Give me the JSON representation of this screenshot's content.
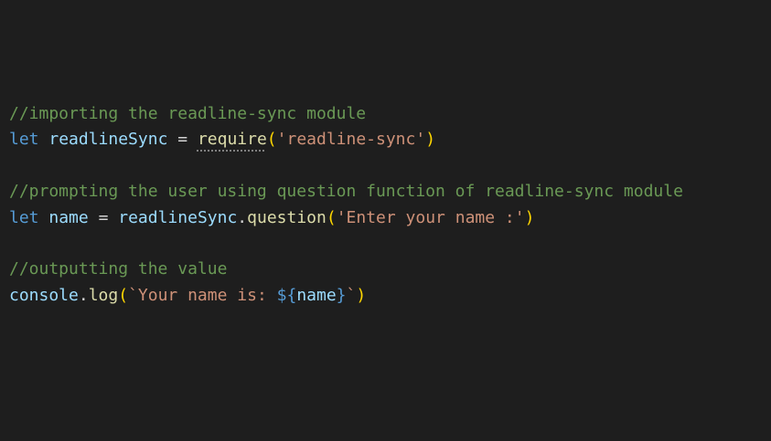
{
  "editor": {
    "theme": {
      "background": "#1e1e1e",
      "comment": "#6a9955",
      "keyword": "#569cd6",
      "variable": "#9cdcfe",
      "function": "#dcdcaa",
      "string": "#ce9178",
      "bracket": "#ffd700",
      "plain": "#d4d4d4"
    },
    "lines": {
      "l1": {
        "comment": "//importing the readline-sync module"
      },
      "l2": {
        "keyword": "let",
        "var": "readlineSync",
        "op": "=",
        "func": "require",
        "open": "(",
        "arg": "'readline-sync'",
        "close": ")"
      },
      "l3": {
        "comment": "//prompting the user using question function of readline-sync module"
      },
      "l4": {
        "keyword": "let",
        "var": "name",
        "op": "=",
        "obj": "readlineSync",
        "dot": ".",
        "method": "question",
        "open": "(",
        "arg": "'Enter your name :'",
        "close": ")"
      },
      "l5": {
        "comment": "//outputting the value"
      },
      "l6": {
        "obj": "console",
        "dot": ".",
        "method": "log",
        "open": "(",
        "tick_open": "`",
        "text": "Your name is: ",
        "interp_open": "${",
        "interp_var": "name",
        "interp_close": "}",
        "tick_close": "`",
        "close": ")"
      }
    }
  }
}
